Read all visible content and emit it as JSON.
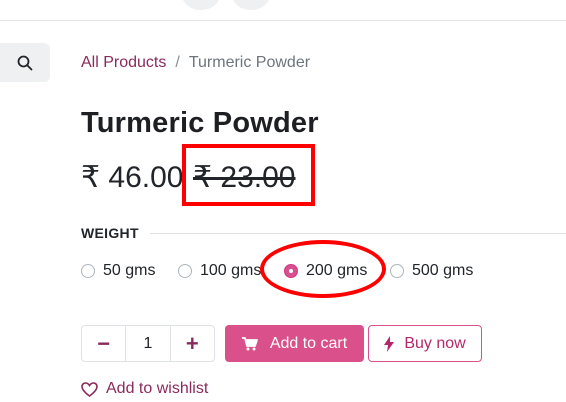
{
  "breadcrumb": {
    "link": "All Products",
    "separator": "/",
    "current": "Turmeric Powder"
  },
  "product": {
    "title": "Turmeric Powder",
    "price": "₹ 46.00",
    "old_price": "₹ 23.00"
  },
  "weight": {
    "label": "WEIGHT",
    "options": [
      "50 gms",
      "100 gms",
      "200 gms",
      "500 gms"
    ],
    "selected": "200 gms"
  },
  "quantity": {
    "minus": "−",
    "value": "1",
    "plus": "+"
  },
  "actions": {
    "add_to_cart": "Add to cart",
    "buy_now": "Buy now",
    "wishlist": "Add to wishlist"
  },
  "icons": {
    "search": "search-icon",
    "cart": "cart-icon",
    "bolt": "bolt-icon",
    "heart": "heart-icon"
  },
  "colors": {
    "brand": "#8a2a5c",
    "primary_button": "#d9508a",
    "annotation": "#ff0000"
  }
}
